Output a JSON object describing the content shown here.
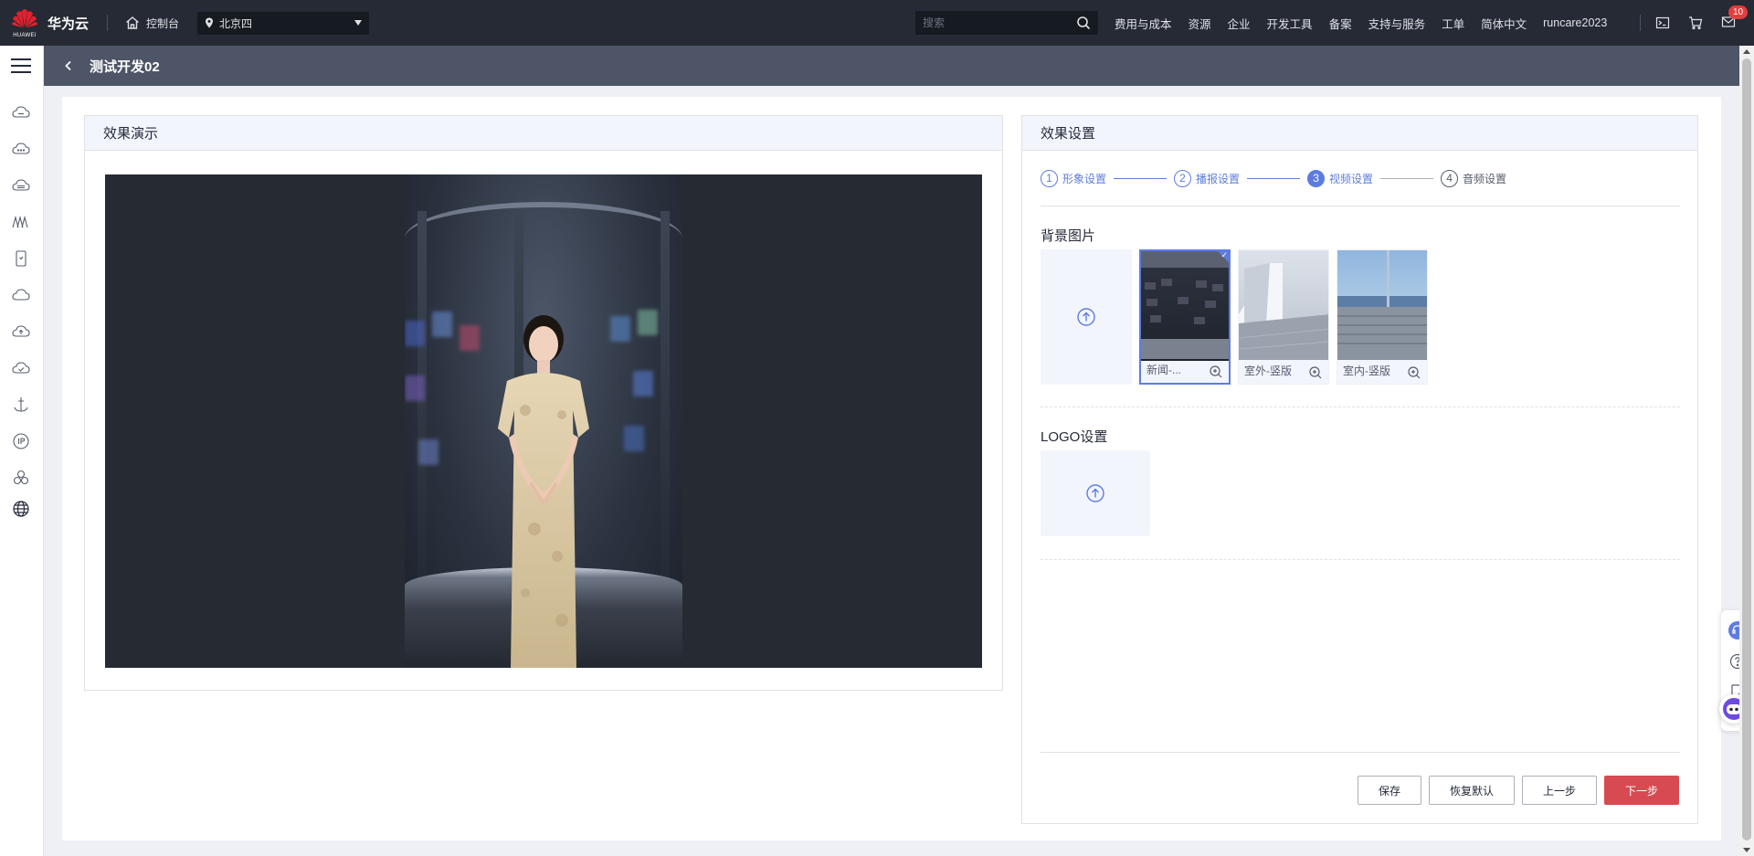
{
  "brand": {
    "logo_text": "HUAWEI",
    "name": "华为云"
  },
  "topbar": {
    "console_label": "控制台",
    "region": "北京四",
    "search_placeholder": "搜索",
    "nav": [
      "费用与成本",
      "资源",
      "企业",
      "开发工具",
      "备案",
      "支持与服务",
      "工单",
      "简体中文",
      "runcare2023"
    ],
    "mail_badge": "10"
  },
  "page": {
    "title": "测试开发02"
  },
  "left_panel": {
    "title": "效果演示"
  },
  "right_panel": {
    "title": "效果设置",
    "steps": [
      {
        "num": "1",
        "label": "形象设置",
        "state": "done"
      },
      {
        "num": "2",
        "label": "播报设置",
        "state": "done"
      },
      {
        "num": "3",
        "label": "视频设置",
        "state": "active"
      },
      {
        "num": "4",
        "label": "音频设置",
        "state": "todo"
      }
    ],
    "background_title": "背景图片",
    "backgrounds": [
      {
        "caption": "新闻-...",
        "selected": true
      },
      {
        "caption": "室外-竖版",
        "selected": false
      },
      {
        "caption": "室内-竖版",
        "selected": false
      }
    ],
    "logo_title": "LOGO设置",
    "buttons": {
      "save": "保存",
      "reset": "恢复默认",
      "prev": "上一步",
      "next": "下一步"
    }
  },
  "colors": {
    "accent": "#5e7ce0",
    "danger": "#d84a52",
    "topbar": "#252a34",
    "header": "#4d5566"
  }
}
